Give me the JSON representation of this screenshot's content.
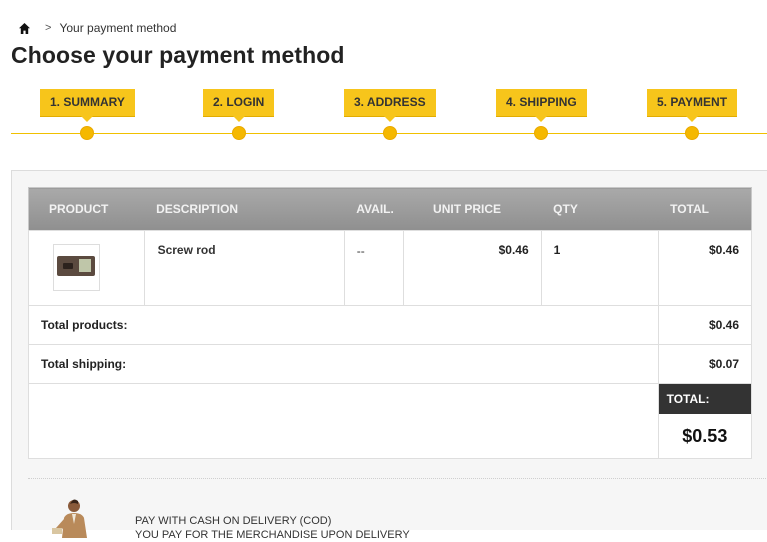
{
  "breadcrumb": {
    "separator": ">",
    "current": "Your payment method"
  },
  "page": {
    "title": "Choose your payment method"
  },
  "steps": [
    {
      "label": "1. SUMMARY"
    },
    {
      "label": "2. LOGIN"
    },
    {
      "label": "3. ADDRESS"
    },
    {
      "label": "4. SHIPPING"
    },
    {
      "label": "5. PAYMENT"
    }
  ],
  "cart": {
    "columns": [
      "PRODUCT",
      "DESCRIPTION",
      "AVAIL.",
      "UNIT PRICE",
      "QTY",
      "TOTAL"
    ],
    "rows": [
      {
        "description": "Screw rod",
        "availability": "--",
        "unit_price": "$0.46",
        "qty": "1",
        "total": "$0.46"
      }
    ],
    "totals": {
      "products_label": "Total products:",
      "products_value": "$0.46",
      "shipping_label": "Total shipping:",
      "shipping_value": "$0.07",
      "grand_label": "TOTAL:",
      "grand_value": "$0.53"
    }
  },
  "payment_options": {
    "cod_line1": "PAY WITH CASH ON DELIVERY (COD)",
    "cod_line2": "YOU PAY FOR THE MERCHANDISE UPON DELIVERY"
  },
  "colors": {
    "accent": "#f7c51b",
    "header_gray": "#9a9a9a",
    "dark": "#333333"
  }
}
